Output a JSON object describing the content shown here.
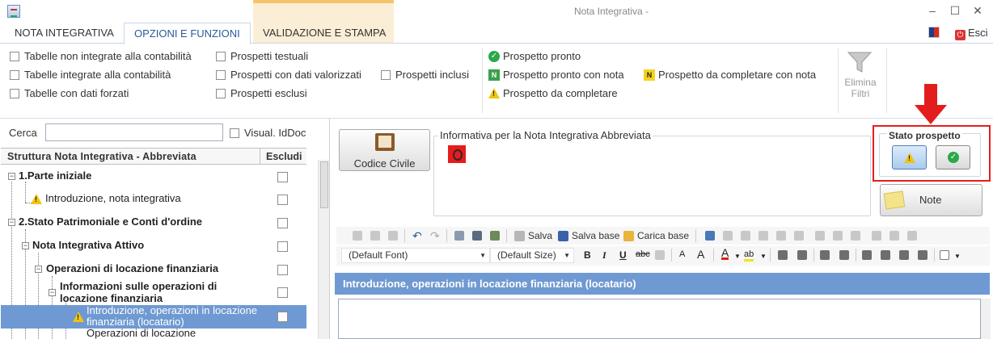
{
  "window": {
    "title": "Nota Integrativa -",
    "minimize": "–",
    "maximize": "☐",
    "close": "✕"
  },
  "tabs": [
    {
      "label": "NOTA INTEGRATIVA"
    },
    {
      "label": "OPZIONI E FUNZIONI"
    },
    {
      "label": "VALIDAZIONE E STAMPA"
    }
  ],
  "header": {
    "exit_label": "Esci"
  },
  "filters": {
    "col1": [
      "Tabelle non integrate alla contabilità",
      "Tabelle integrate alla contabilità",
      "Tabelle con dati forzati"
    ],
    "col2": [
      "Prospetti testuali",
      "Prospetti con dati valorizzati",
      "Prospetti esclusi"
    ],
    "col3": [
      "Prospetti inclusi"
    ]
  },
  "legend": {
    "pronto": "Prospetto pronto",
    "pronto_nota": "Prospetto pronto con nota",
    "completare_nota": "Prospetto da completare con nota",
    "completare": "Prospetto da completare",
    "n_glyph": "N"
  },
  "elimina_filtri": "Elimina Filtri",
  "search": {
    "label": "Cerca",
    "value": "",
    "visual_iddoc": "Visual. IdDoc"
  },
  "tree": {
    "header_name": "Struttura Nota Integrativa - Abbreviata",
    "header_exclude": "Escludi",
    "rows": [
      {
        "label": "1.Parte iniziale"
      },
      {
        "label": "Introduzione, nota integrativa"
      },
      {
        "label": "2.Stato Patrimoniale e Conti d'ordine"
      },
      {
        "label": "Nota Integrativa Attivo"
      },
      {
        "label": "Operazioni di locazione finanziaria"
      },
      {
        "label": "Informazioni sulle operazioni di locazione finanziaria"
      },
      {
        "label": "Introduzione, operazioni in locazione finanziaria (locatario)"
      },
      {
        "label": "Operazioni di locazione"
      }
    ]
  },
  "codice_civile": "Codice Civile",
  "info_group_title": "Informativa per la Nota Integrativa Abbreviata",
  "stato": {
    "title": "Stato prospetto"
  },
  "note_label": "Note",
  "toolbar": {
    "salva": "Salva",
    "salva_base": "Salva base",
    "carica_base": "Carica base",
    "font": "(Default Font)",
    "size": "(Default Size)",
    "bold": "B",
    "italic": "I",
    "underline": "U",
    "strike": "abc",
    "grow": "A",
    "shrink": "A",
    "fontcolor": "A",
    "highlight": "ab"
  },
  "section_title": "Introduzione, operazioni in locazione finanziaria (locatario)",
  "colors": {
    "accent_blue": "#6f99d2",
    "highlight_red": "#e31d1d",
    "ok_green": "#2aa84a",
    "warn_yellow": "#f1c40f"
  }
}
